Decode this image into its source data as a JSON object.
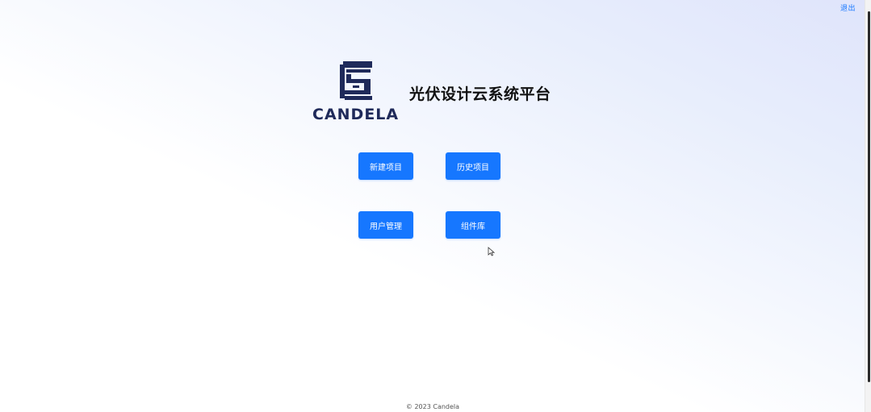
{
  "header": {
    "logout_label": "退出"
  },
  "logo": {
    "icon": "candela-logo-icon",
    "text": "CANDELA",
    "color": "#1f2a5a"
  },
  "page": {
    "title": "光伏设计云系统平台"
  },
  "buttons": {
    "new_project": "新建项目",
    "history_project": "历史项目",
    "user_management": "用户管理",
    "component_library": "组件库"
  },
  "footer": {
    "copyright": "© 2023 Candela"
  },
  "theme": {
    "accent": "#1677ff"
  }
}
